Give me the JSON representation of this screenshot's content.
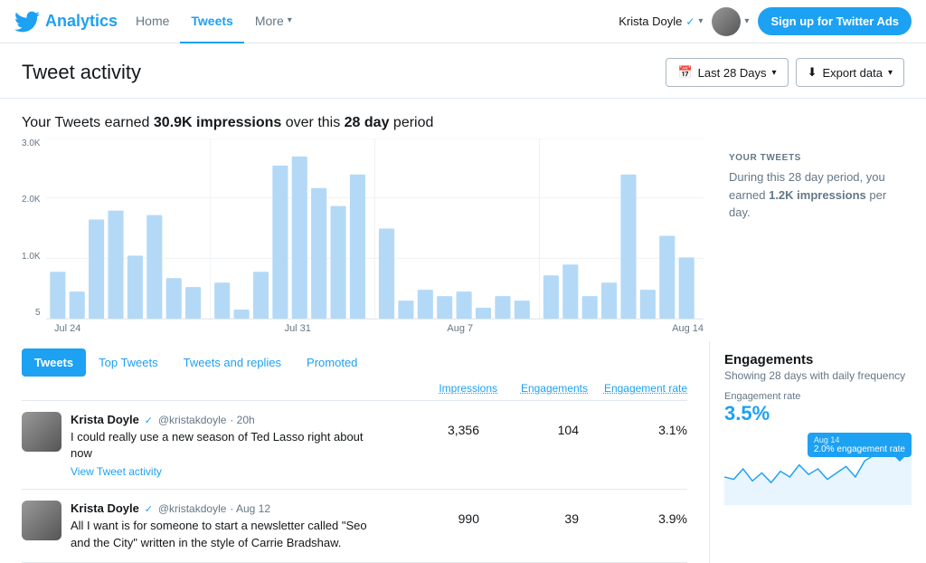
{
  "nav": {
    "brand": "Analytics",
    "logo_title": "Twitter",
    "links": [
      {
        "label": "Home",
        "active": false
      },
      {
        "label": "Tweets",
        "active": true
      },
      {
        "label": "More",
        "active": false,
        "has_dropdown": true
      }
    ],
    "user_name": "Krista Doyle",
    "signup_label": "Sign up for Twitter Ads"
  },
  "header": {
    "title": "Tweet activity",
    "date_filter_label": "Last 28 Days",
    "export_label": "Export data"
  },
  "summary": {
    "prefix": "Your Tweets earned ",
    "impressions": "30.9K impressions",
    "suffix": " over this ",
    "period": "28 day",
    "suffix2": " period"
  },
  "chart": {
    "y_labels": [
      "3.0K",
      "2.0K",
      "1.0K",
      "5"
    ],
    "dates": [
      "Jul 24",
      "Jul 31",
      "Aug 7",
      "Aug 14"
    ],
    "your_tweets_label": "YOUR TWEETS",
    "your_tweets_text": "During this 28 day period, you earned ",
    "your_tweets_bold": "1.2K impressions",
    "your_tweets_suffix": " per day."
  },
  "tabs": [
    {
      "label": "Tweets",
      "active": true
    },
    {
      "label": "Top Tweets",
      "active": false
    },
    {
      "label": "Tweets and replies",
      "active": false
    },
    {
      "label": "Promoted",
      "active": false
    }
  ],
  "columns": [
    {
      "label": "Impressions"
    },
    {
      "label": "Engagements"
    },
    {
      "label": "Engagement rate"
    }
  ],
  "tweets": [
    {
      "author": "Krista Doyle",
      "handle": "@kristakdoyle",
      "time": "20h",
      "text": "I could really use a new season of Ted Lasso right about now",
      "activity_link": "View Tweet activity",
      "impressions": "3,356",
      "engagements": "104",
      "engagement_rate": "3.1%"
    },
    {
      "author": "Krista Doyle",
      "handle": "@kristakdoyle",
      "time": "Aug 12",
      "text": "All I want is for someone to start a newsletter called \"Seo and the City\" written in the style of Carrie Bradshaw.",
      "activity_link": "",
      "impressions": "990",
      "engagements": "39",
      "engagement_rate": "3.9%"
    }
  ],
  "right_panel": {
    "title": "Engagements",
    "subtitle": "Showing 28 days with daily frequency",
    "engagement_rate_label": "Engagement rate",
    "engagement_rate_value": "3.5%",
    "tooltip_date": "Aug 14",
    "tooltip_text": "2.0% engagement rate"
  }
}
